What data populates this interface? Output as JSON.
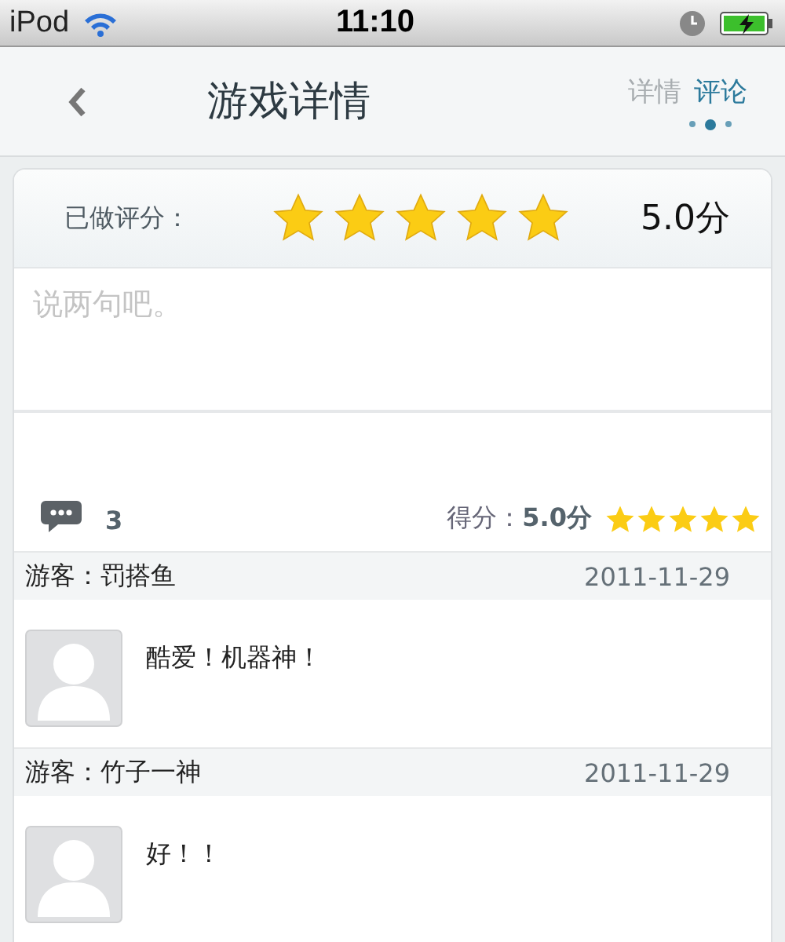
{
  "status_bar": {
    "device": "iPod",
    "time": "11:10"
  },
  "nav": {
    "title": "游戏详情",
    "tabs": [
      {
        "label": "详情",
        "selected": false
      },
      {
        "label": "评论",
        "selected": true
      }
    ],
    "pager": [
      {
        "selected": false
      },
      {
        "selected": true
      },
      {
        "selected": false
      }
    ]
  },
  "rating": {
    "label": "已做评分：",
    "stars": 5,
    "score": "5.0分"
  },
  "comment_field": {
    "placeholder": "说两句吧。"
  },
  "summary": {
    "count": "3",
    "score_label": "得分：",
    "score": "5.0分",
    "stars": 5
  },
  "comments": [
    {
      "user": "游客：罚搭鱼",
      "date": "2011-11-29",
      "text": "酷爱！机器神！"
    },
    {
      "user": "游客：竹子一神",
      "date": "2011-11-29",
      "text": "好！！"
    }
  ]
}
